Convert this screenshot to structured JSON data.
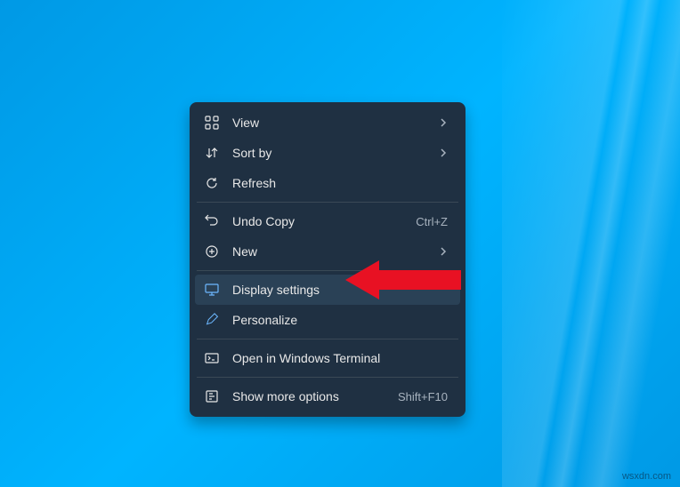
{
  "menu": {
    "view": {
      "label": "View"
    },
    "sortby": {
      "label": "Sort by"
    },
    "refresh": {
      "label": "Refresh"
    },
    "undocopy": {
      "label": "Undo Copy",
      "shortcut": "Ctrl+Z"
    },
    "new": {
      "label": "New"
    },
    "display": {
      "label": "Display settings"
    },
    "personalize": {
      "label": "Personalize"
    },
    "terminal": {
      "label": "Open in Windows Terminal"
    },
    "more": {
      "label": "Show more options",
      "shortcut": "Shift+F10"
    }
  },
  "watermark": "wsxdn.com"
}
